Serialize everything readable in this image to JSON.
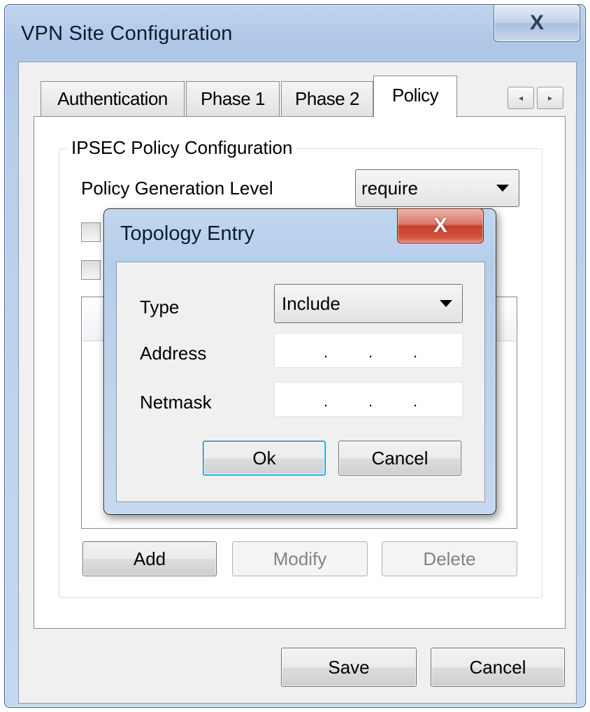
{
  "window": {
    "title": "VPN Site Configuration",
    "close_glyph": "X"
  },
  "tabs": [
    {
      "label": "Authentication",
      "active": false
    },
    {
      "label": "Phase 1",
      "active": false
    },
    {
      "label": "Phase 2",
      "active": false
    },
    {
      "label": "Policy",
      "active": true
    }
  ],
  "tab_scroll": {
    "left_glyph": "◂",
    "right_glyph": "▸"
  },
  "policy": {
    "group_title": "IPSEC Policy Configuration",
    "generation_level_label": "Policy Generation Level",
    "generation_level_value": "require",
    "buttons": {
      "add": "Add",
      "modify": "Modify",
      "delete": "Delete"
    }
  },
  "footer": {
    "save": "Save",
    "cancel": "Cancel"
  },
  "dialog": {
    "title": "Topology Entry",
    "close_glyph": "X",
    "type_label": "Type",
    "type_value": "Include",
    "address_label": "Address",
    "netmask_label": "Netmask",
    "ip_dot": ".",
    "ok": "Ok",
    "cancel": "Cancel"
  },
  "colors": {
    "window_frame": "#b8cfeb",
    "client_bg": "#f0f0f0",
    "dialog_close_red": "#c6402c",
    "focus_blue": "#3c7fb1"
  }
}
